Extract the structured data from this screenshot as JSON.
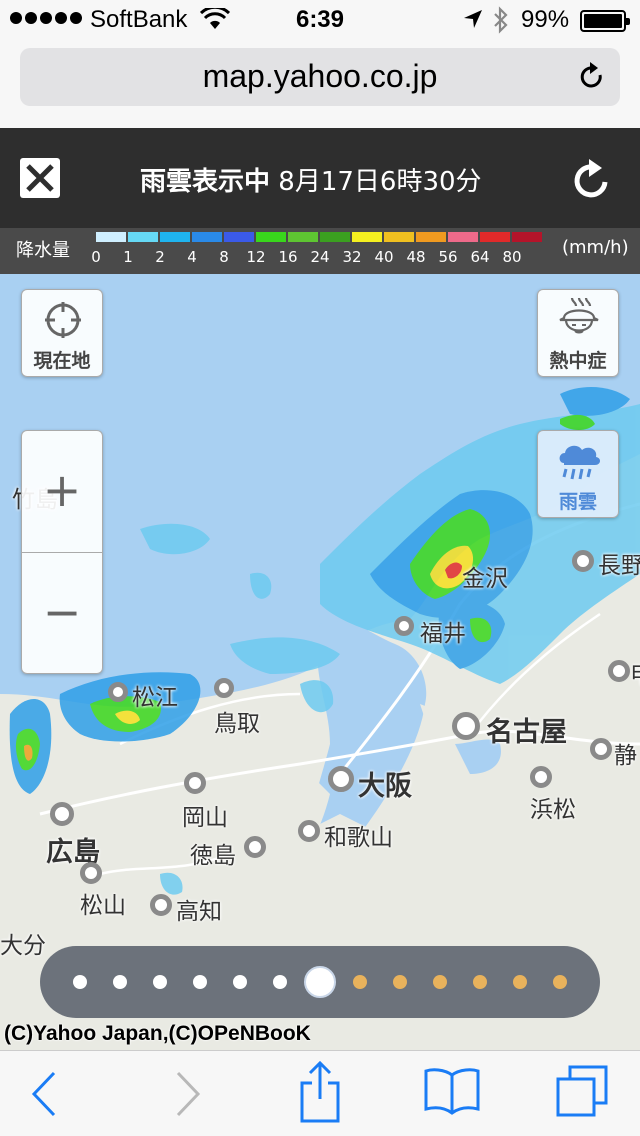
{
  "status_bar": {
    "carrier": "SoftBank",
    "time": "6:39",
    "battery": "99%"
  },
  "url_bar": {
    "url": "map.yahoo.co.jp",
    "reload_icon": "reload-icon"
  },
  "header": {
    "close_icon": "close-icon",
    "mode": "雨雲表示中",
    "datetime": "8月17日6時30分",
    "refresh_icon": "refresh-icon"
  },
  "legend": {
    "label": "降水量",
    "unit": "(mm/h)",
    "ticks": [
      "0",
      "1",
      "2",
      "4",
      "8",
      "12",
      "16",
      "24",
      "32",
      "40",
      "48",
      "56",
      "64",
      "80"
    ],
    "colors": [
      "#cfefff",
      "#66d9f5",
      "#1fb4ef",
      "#2a8ae8",
      "#3b5ae8",
      "#39d71c",
      "#5ec532",
      "#3ba020",
      "#f5f020",
      "#f0c020",
      "#f09a20",
      "#ee6a8a",
      "#e02a2a",
      "#b4142a"
    ]
  },
  "map": {
    "current_location_label": "現在地",
    "heatstroke_label": "熱中症",
    "rain_cloud_label": "雨雲",
    "zoom_in": "+",
    "zoom_out": "−",
    "cities": {
      "takeshima": "竹島",
      "nagano": "長野",
      "kanazawa": "金沢",
      "fukui": "福井",
      "matsue": "松江",
      "tottori": "鳥取",
      "nagoya": "名古屋",
      "shizuoka": "静",
      "osaka": "大阪",
      "hamamatsu": "浜松",
      "okayama": "岡山",
      "wakayama": "和歌山",
      "hiroshima": "広島",
      "tokushima": "徳島",
      "matsuyama": "松山",
      "kochi": "高知",
      "oita": "大分",
      "city_partial": "甲"
    },
    "copyright": "(C)Yahoo Japan,(C)OPeNBooK"
  },
  "timeline": {
    "steps": [
      "past",
      "past",
      "past",
      "past",
      "past",
      "past",
      "current",
      "future",
      "future",
      "future",
      "future",
      "future",
      "future"
    ],
    "past_color": "#ffffff",
    "future_color": "#e8b25c"
  },
  "toolbar": {
    "back_icon": "back-icon",
    "forward_icon": "forward-icon",
    "share_icon": "share-icon",
    "bookmarks_icon": "bookmarks-icon",
    "tabs_icon": "tabs-icon",
    "accent_color": "#1a7cf5"
  }
}
